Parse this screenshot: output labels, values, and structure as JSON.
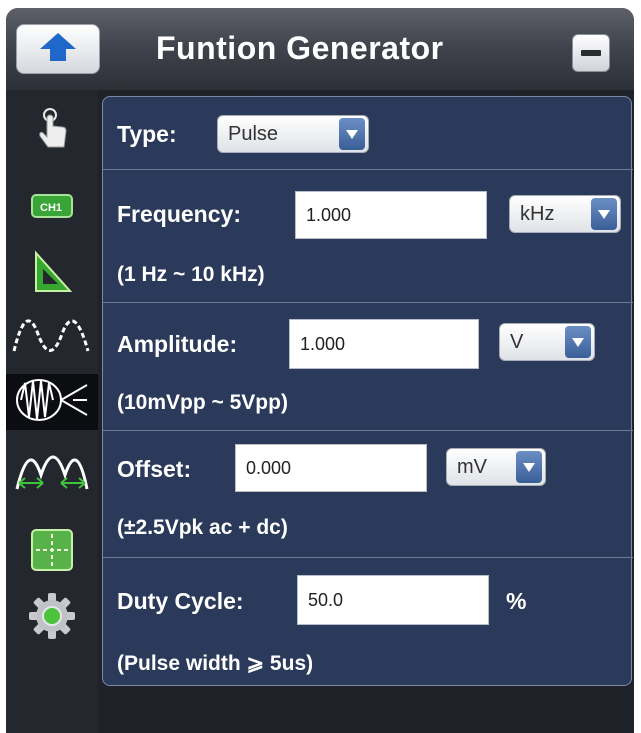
{
  "window": {
    "title": "Funtion Generator"
  },
  "sidebar": {
    "items": [
      {
        "icon": "hand-pointer-icon"
      },
      {
        "icon": "channel-icon",
        "label": "CH1"
      },
      {
        "icon": "ruler-triangle-icon"
      },
      {
        "icon": "waveform-icon"
      },
      {
        "icon": "signal-generator-icon",
        "active": true
      },
      {
        "icon": "waveform-measure-icon"
      },
      {
        "icon": "cursor-crosshair-icon"
      },
      {
        "icon": "gear-icon"
      }
    ]
  },
  "form": {
    "type": {
      "label": "Type:",
      "value": "Pulse"
    },
    "frequency": {
      "label": "Frequency:",
      "value": "1.000",
      "unit": "kHz",
      "range": "(1 Hz ~ 10 kHz)"
    },
    "amplitude": {
      "label": "Amplitude:",
      "value": "1.000",
      "unit": "V",
      "range": "(10mVpp ~ 5Vpp)"
    },
    "offset": {
      "label": "Offset:",
      "value": "0.000",
      "unit": "mV",
      "range": "(±2.5Vpk ac + dc)"
    },
    "duty_cycle": {
      "label": "Duty Cycle:",
      "value": "50.0",
      "unit": "%",
      "note": "(Pulse width ⩾ 5us)"
    }
  },
  "colors": {
    "panel": "#2b3a5a",
    "window": "#20222a",
    "accent": "#3a5f98",
    "icon_green": "#35a82f"
  }
}
